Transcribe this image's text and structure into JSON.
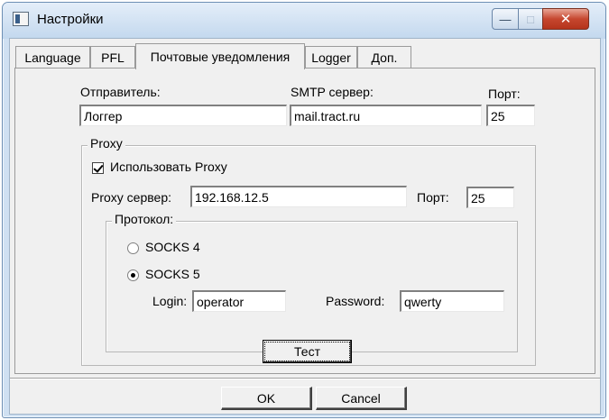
{
  "window": {
    "title": "Настройки",
    "controls": {
      "minimize": "—",
      "maximize": "□",
      "close": "✕"
    }
  },
  "tabs": [
    {
      "label": "Language"
    },
    {
      "label": "PFL"
    },
    {
      "label": "Почтовые уведомления",
      "active": true
    },
    {
      "label": "Logger"
    },
    {
      "label": "Доп."
    }
  ],
  "mail": {
    "sender_label": "Отправитель:",
    "sender_value": "Логгер",
    "smtp_label": "SMTP сервер:",
    "smtp_value": "mail.tract.ru",
    "port_label": "Порт:",
    "port_value": "25"
  },
  "proxy": {
    "group_label": "Proxy",
    "use_proxy_label": "Использовать Proxy",
    "use_proxy_checked": true,
    "server_label": "Proxy сервер:",
    "server_value": "192.168.12.5",
    "port_label": "Порт:",
    "port_value": "25",
    "protocol": {
      "group_label": "Протокол:",
      "socks4_label": "SOCKS 4",
      "socks5_label": "SOCKS 5",
      "selected": "SOCKS 5",
      "login_label": "Login:",
      "login_value": "operator",
      "password_label": "Password:",
      "password_value": "qwerty"
    }
  },
  "buttons": {
    "test": "Тест",
    "ok": "OK",
    "cancel": "Cancel"
  }
}
